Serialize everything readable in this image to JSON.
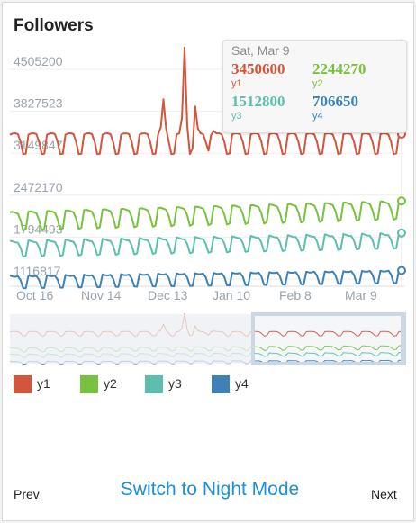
{
  "chart_data": {
    "type": "line",
    "title": "Followers",
    "x_ticks": [
      "Oct 16",
      "Nov 14",
      "Dec 13",
      "Jan 10",
      "Feb 8",
      "Mar 9"
    ],
    "y_ticks": [
      4505200,
      3827523,
      3149847,
      2472170,
      1794493,
      1116817
    ],
    "ylim": [
      1000000,
      4800000
    ],
    "grid": true,
    "legend_position": "bottom",
    "series": [
      {
        "name": "y1",
        "color": "#d2553c",
        "base": 3450000,
        "amp": 290000,
        "trend": 0,
        "spikes": [
          [
            66,
            1400000
          ],
          [
            58,
            550000
          ],
          [
            70,
            450000
          ],
          [
            76,
            300000
          ]
        ]
      },
      {
        "name": "y2",
        "color": "#77c23e",
        "base": 2180000,
        "amp": 270000,
        "trend": 180000,
        "spikes": []
      },
      {
        "name": "y3",
        "color": "#5cbfad",
        "base": 1720000,
        "amp": 250000,
        "trend": 130000,
        "spikes": []
      },
      {
        "name": "y4",
        "color": "#3c82b6",
        "base": 1170000,
        "amp": 220000,
        "trend": 90000,
        "spikes": []
      }
    ],
    "tooltip": {
      "date": "Sat, Mar 9",
      "values": [
        {
          "name": "y1",
          "value": "3450600",
          "color": "#d2553c"
        },
        {
          "name": "y2",
          "value": "2244270",
          "color": "#77c23e"
        },
        {
          "name": "y3",
          "value": "1512800",
          "color": "#5cbfad"
        },
        {
          "name": "y4",
          "value": "706650",
          "color": "#3c82b6"
        }
      ]
    }
  },
  "controls": {
    "prev_label": "Prev",
    "next_label": "Next",
    "night_mode_label": "Switch to Night Mode"
  }
}
